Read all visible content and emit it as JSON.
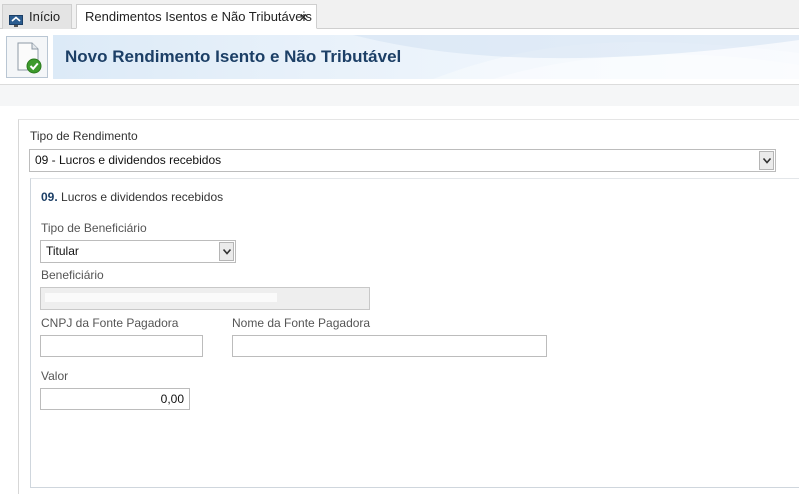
{
  "tabs": [
    {
      "label": "Início",
      "icon": "home-monitor-icon"
    },
    {
      "label": "Rendimentos Isentos e Não Tributáveis",
      "close": "×"
    }
  ],
  "header": {
    "title": "Novo Rendimento Isento e Não Tributável",
    "icon": "document-check-icon",
    "accent": "#1c3f66"
  },
  "form": {
    "tipo_rendimento": {
      "label": "Tipo de Rendimento",
      "value": "09 - Lucros e dividendos recebidos"
    },
    "section": {
      "number": "09.",
      "title": " Lucros e dividendos recebidos"
    },
    "tipo_beneficiario": {
      "label": "Tipo de Beneficiário",
      "value": "Titular"
    },
    "beneficiario": {
      "label": "Beneficiário",
      "value": ""
    },
    "cnpj": {
      "label": "CNPJ da Fonte Pagadora",
      "value": ""
    },
    "nome_fonte": {
      "label": "Nome da Fonte Pagadora",
      "value": ""
    },
    "valor": {
      "label": "Valor",
      "value": "0,00"
    }
  }
}
